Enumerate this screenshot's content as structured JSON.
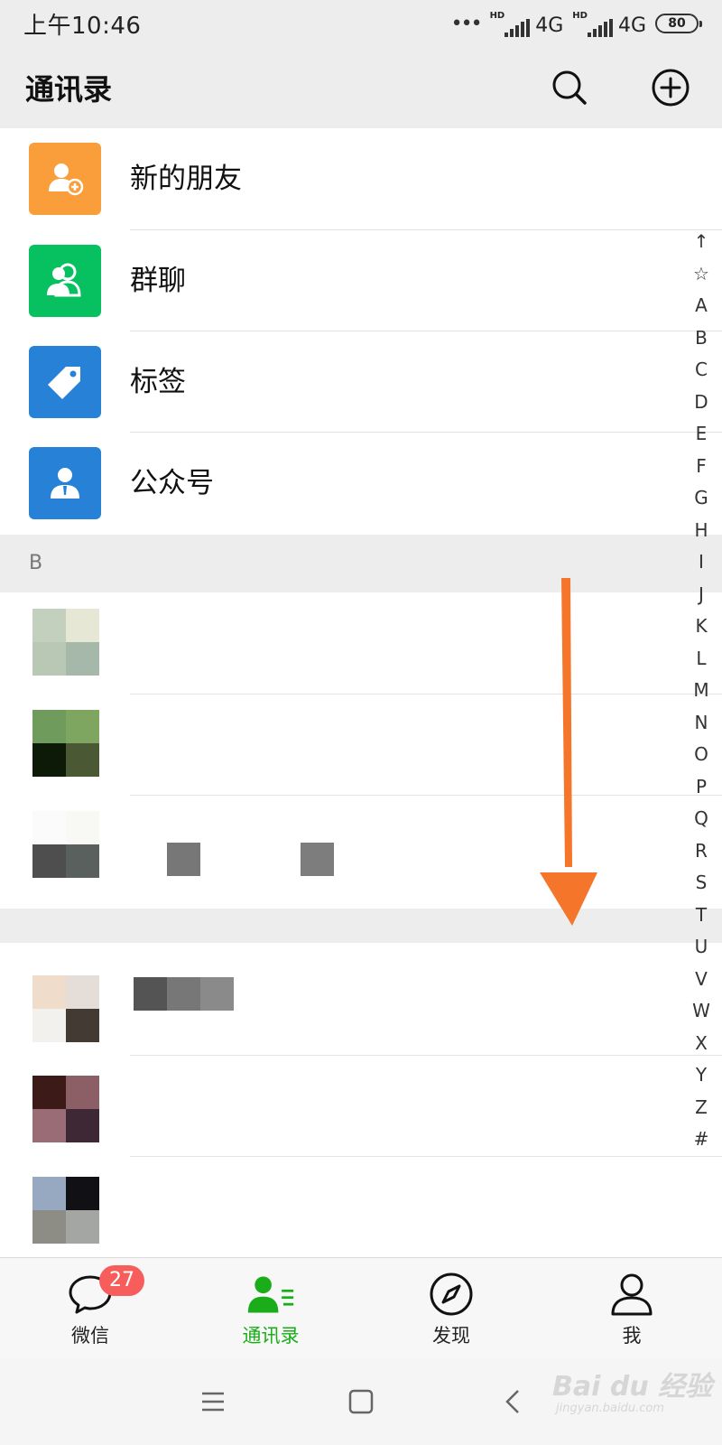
{
  "status_bar": {
    "time": "上午10:46",
    "dots": "•••",
    "hd": "HD",
    "network_1": "4G",
    "network_2": "4G",
    "battery": "80"
  },
  "header": {
    "title": "通讯录",
    "search_icon": "search-icon",
    "add_icon": "plus-circle-icon"
  },
  "entries": [
    {
      "label": "新的朋友",
      "icon": "add-friend-icon",
      "color": "#fa9d3b"
    },
    {
      "label": "群聊",
      "icon": "group-chat-icon",
      "color": "#07c160"
    },
    {
      "label": "标签",
      "icon": "tag-icon",
      "color": "#2782d7"
    },
    {
      "label": "公众号",
      "icon": "official-account-icon",
      "color": "#2782d7"
    }
  ],
  "section_b": {
    "letter": "B"
  },
  "index_bar": [
    "↑",
    "☆",
    "A",
    "B",
    "C",
    "D",
    "E",
    "F",
    "G",
    "H",
    "I",
    "J",
    "K",
    "L",
    "M",
    "N",
    "O",
    "P",
    "Q",
    "R",
    "S",
    "T",
    "U",
    "V",
    "W",
    "X",
    "Y",
    "Z",
    "#"
  ],
  "tabs": [
    {
      "label": "微信",
      "icon": "chat-bubble-icon",
      "badge": "27",
      "active": false
    },
    {
      "label": "通讯录",
      "icon": "contacts-icon",
      "active": true
    },
    {
      "label": "发现",
      "icon": "compass-icon",
      "active": false
    },
    {
      "label": "我",
      "icon": "person-icon",
      "active": false
    }
  ],
  "colors": {
    "accent": "#1aad19",
    "badge": "#f65d5b",
    "arrow": "#f5762a",
    "header_bg": "#ededed"
  },
  "watermark": {
    "main": "Bai du 经验",
    "sub": "jingyan.baidu.com"
  }
}
